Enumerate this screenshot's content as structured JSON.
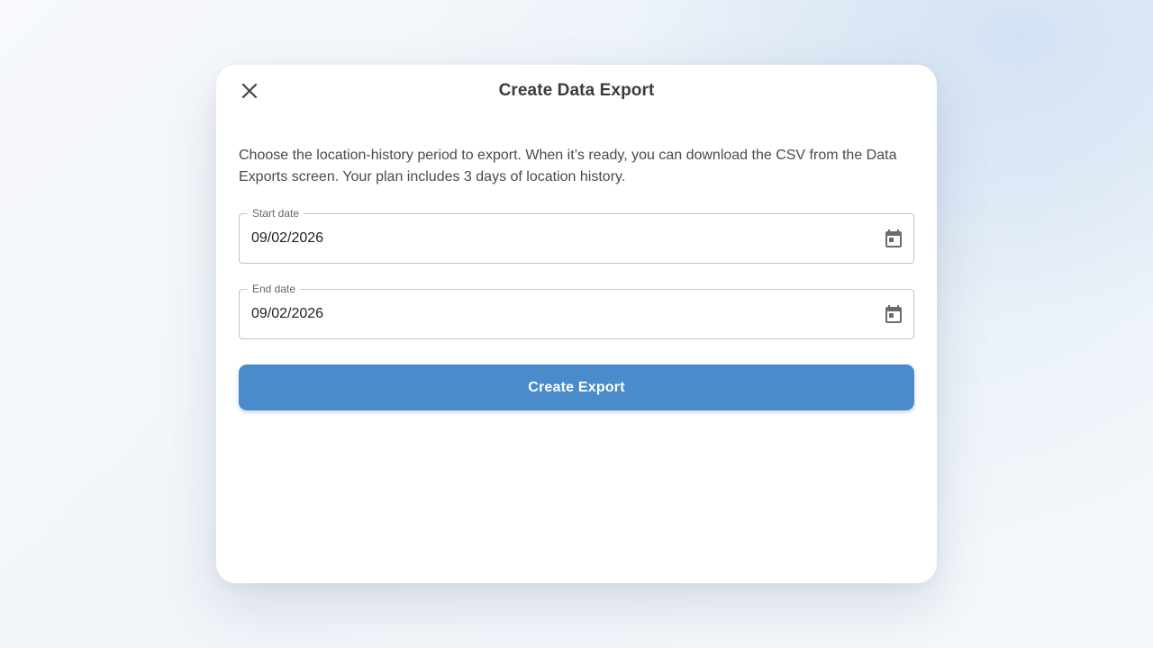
{
  "dialog": {
    "title": "Create Data Export",
    "close_icon": "close-icon",
    "description": "Choose the location-history period to export. When it’s ready, you can download the CSV from the Data Exports screen. Your plan includes 3 days of location history.",
    "start_date": {
      "label": "Start date",
      "value": "09/02/2026",
      "icon": "calendar-icon"
    },
    "end_date": {
      "label": "End date",
      "value": "09/02/2026",
      "icon": "calendar-icon"
    },
    "submit_label": "Create Export"
  },
  "colors": {
    "accent": "#4a8bcb",
    "title_text": "#3c3c3c",
    "body_text": "#4a4a4a",
    "field_border": "#c4c4c4"
  }
}
